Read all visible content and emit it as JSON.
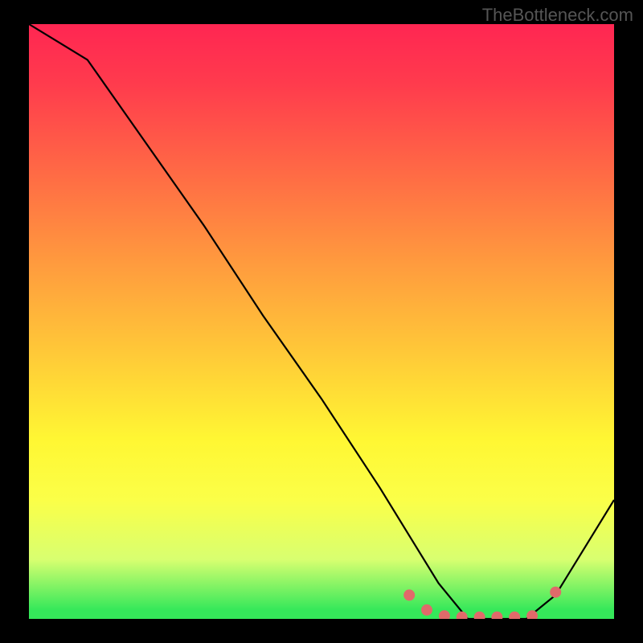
{
  "watermark": "TheBottleneck.com",
  "chart_data": {
    "type": "line",
    "title": "",
    "xlabel": "",
    "ylabel": "",
    "xlim": [
      0,
      100
    ],
    "ylim": [
      0,
      100
    ],
    "series": [
      {
        "name": "bottleneck-curve",
        "x": [
          0,
          5,
          10,
          20,
          30,
          40,
          50,
          60,
          65,
          70,
          75,
          80,
          85,
          90,
          100
        ],
        "values": [
          100,
          97,
          94,
          80,
          66,
          51,
          37,
          22,
          14,
          6,
          0,
          0,
          0,
          4,
          20
        ]
      }
    ],
    "highlight": {
      "name": "pink-dots",
      "x": [
        65,
        68,
        71,
        74,
        77,
        80,
        83,
        86,
        90
      ],
      "values": [
        4,
        1.5,
        0.5,
        0.3,
        0.3,
        0.3,
        0.3,
        0.5,
        4.5
      ]
    },
    "gradient_stops": [
      {
        "pct": 0,
        "color": "#ff2652"
      },
      {
        "pct": 25,
        "color": "#ff6a45"
      },
      {
        "pct": 55,
        "color": "#ffc838"
      },
      {
        "pct": 80,
        "color": "#fbff48"
      },
      {
        "pct": 98.5,
        "color": "#35e85a"
      },
      {
        "pct": 100,
        "color": "#35e85a"
      }
    ]
  }
}
